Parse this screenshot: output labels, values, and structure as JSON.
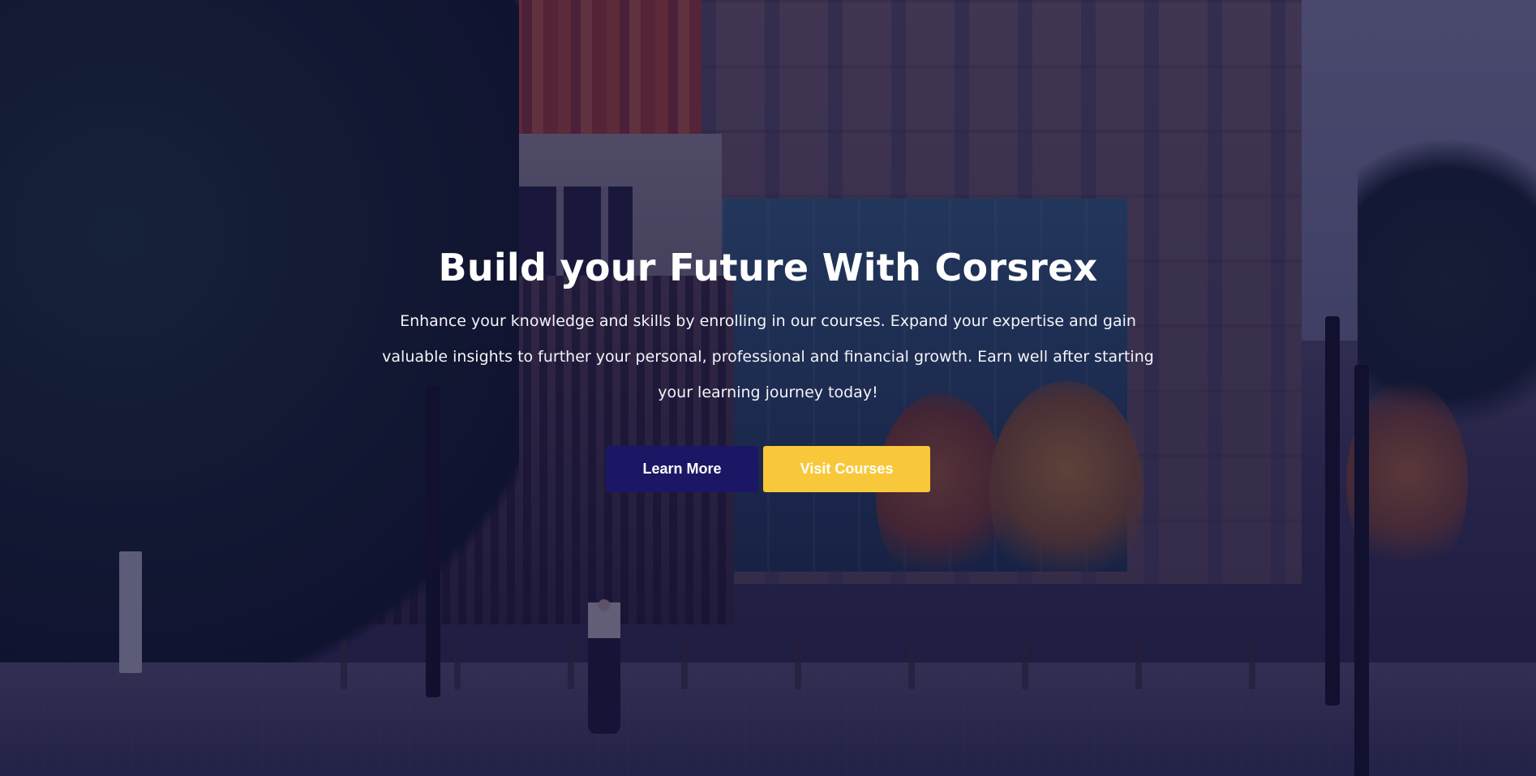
{
  "hero": {
    "title": "Build your Future With Corsrex",
    "description": "Enhance your knowledge and skills by enrolling in our courses. Expand your expertise and gain valuable insights to further your personal, professional and financial growth. Earn well after starting your learning journey today!",
    "buttons": {
      "learn_more": "Learn More",
      "visit_courses": "Visit Courses"
    }
  },
  "colors": {
    "overlay": "#121040",
    "primary_button": "#1b1764",
    "secondary_button": "#f9c83a"
  }
}
